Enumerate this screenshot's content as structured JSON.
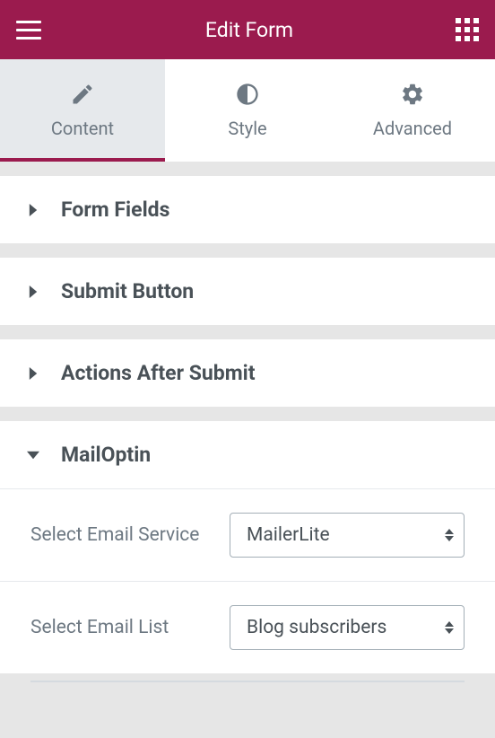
{
  "header": {
    "title": "Edit Form"
  },
  "tabs": {
    "content": "Content",
    "style": "Style",
    "advanced": "Advanced"
  },
  "sections": {
    "form_fields": "Form Fields",
    "submit_button": "Submit Button",
    "actions_after_submit": "Actions After Submit",
    "mailoptin": "MailOptin"
  },
  "controls": {
    "email_service_label": "Select Email Service",
    "email_service_value": "MailerLite",
    "email_list_label": "Select Email List",
    "email_list_value": "Blog subscribers"
  }
}
